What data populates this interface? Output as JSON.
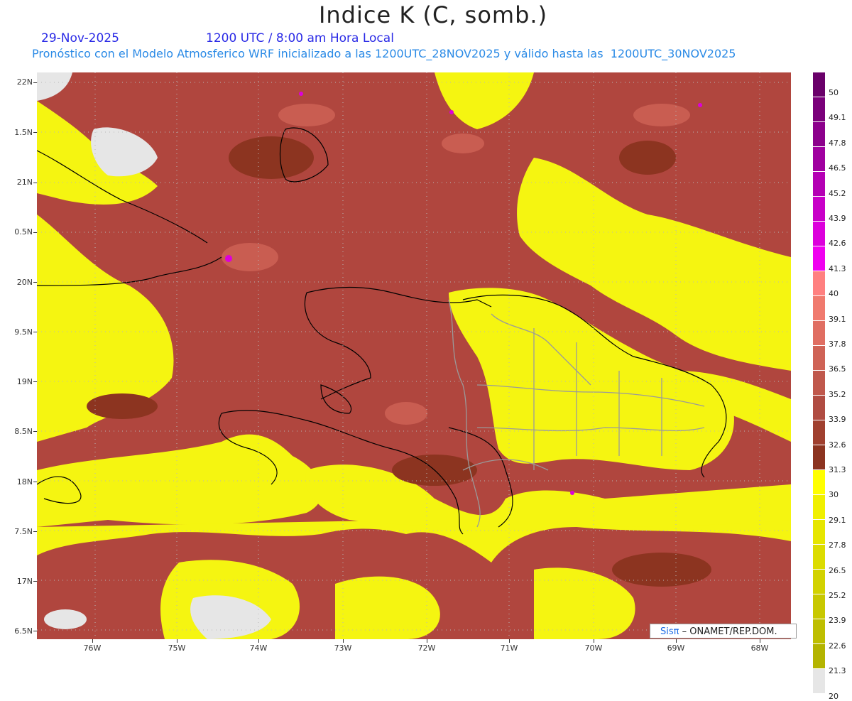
{
  "header": {
    "title": "Indice K (C, somb.)",
    "date": "29-Nov-2025",
    "time": "1200 UTC / 8:00 am Hora Local",
    "subtitle": "Pronóstico con el Modelo Atmosferico WRF inicializado a las 1200UTC_28NOV2025 y válido hasta las  1200UTC_30NOV2025"
  },
  "map": {
    "lat_labels": [
      "22N",
      "1.5N",
      "21N",
      "0.5N",
      "20N",
      "9.5N",
      "19N",
      "8.5N",
      "18N",
      "7.5N",
      "17N",
      "6.5N"
    ],
    "lon_labels": [
      "76W",
      "75W",
      "74W",
      "73W",
      "72W",
      "71W",
      "70W",
      "69W",
      "68W"
    ],
    "credit_brand": "Sisπ",
    "credit_text": " – ONAMET/REP.DOM."
  },
  "colorbar": {
    "labels": [
      "50",
      "49.1",
      "47.8",
      "46.5",
      "45.2",
      "43.9",
      "42.6",
      "41.3",
      "40",
      "39.1",
      "37.8",
      "36.5",
      "35.2",
      "33.9",
      "32.6",
      "31.3",
      "30",
      "29.1",
      "27.8",
      "26.5",
      "25.2",
      "23.9",
      "22.6",
      "21.3",
      "20"
    ],
    "colors": [
      "#6a006a",
      "#7a007a",
      "#8c008c",
      "#a000a0",
      "#b400b4",
      "#c800c8",
      "#dc00dc",
      "#f000f0",
      "#ff8080",
      "#f07a6e",
      "#e06e62",
      "#cf6356",
      "#c0584c",
      "#b04c42",
      "#a0402f",
      "#8c3420",
      "#ffff00",
      "#f0f000",
      "#e6e600",
      "#dcdc00",
      "#d2d200",
      "#c8c800",
      "#bebe00",
      "#b4b400",
      "#e6e6e6"
    ]
  }
}
